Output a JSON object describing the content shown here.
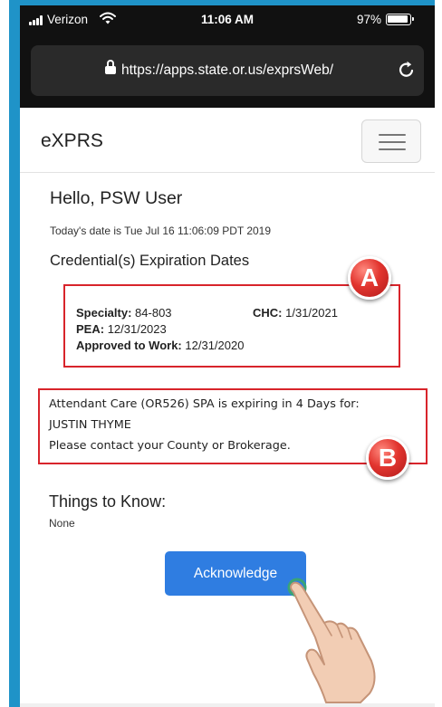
{
  "status_bar": {
    "carrier": "Verizon",
    "time": "11:06 AM",
    "battery": "97%"
  },
  "browser": {
    "url": "https://apps.state.or.us/exprsWeb/"
  },
  "navbar": {
    "brand": "eXPRS"
  },
  "main": {
    "greeting": "Hello, PSW User",
    "today": "Today's date is Tue Jul 16 11:06:09 PDT 2019",
    "credentials_heading": "Credential(s) Expiration Dates",
    "credentials": {
      "specialty_label": "Specialty:",
      "specialty_value": "84-803",
      "chc_label": "CHC:",
      "chc_value": "1/31/2021",
      "pea_label": "PEA:",
      "pea_value": "12/31/2023",
      "approved_label": "Approved to Work:",
      "approved_value": "12/31/2020"
    },
    "message": {
      "line1": "Attendant Care (OR526) SPA is expiring in 4 Days for:",
      "line2": "JUSTIN THYME",
      "line3": "Please contact your County or Brokerage."
    },
    "things_heading": "Things to Know:",
    "things_value": "None",
    "acknowledge_label": "Acknowledge"
  },
  "annotations": {
    "marker_a": "A",
    "marker_b": "B"
  },
  "colors": {
    "frame_blue": "#1f93c8",
    "annotation_red": "#d8242b",
    "button_blue": "#2f7de1"
  },
  "icons": [
    "signal-icon",
    "wifi-icon",
    "battery-icon",
    "lock-icon",
    "reload-icon",
    "hamburger-menu-icon",
    "pointing-hand-icon"
  ]
}
